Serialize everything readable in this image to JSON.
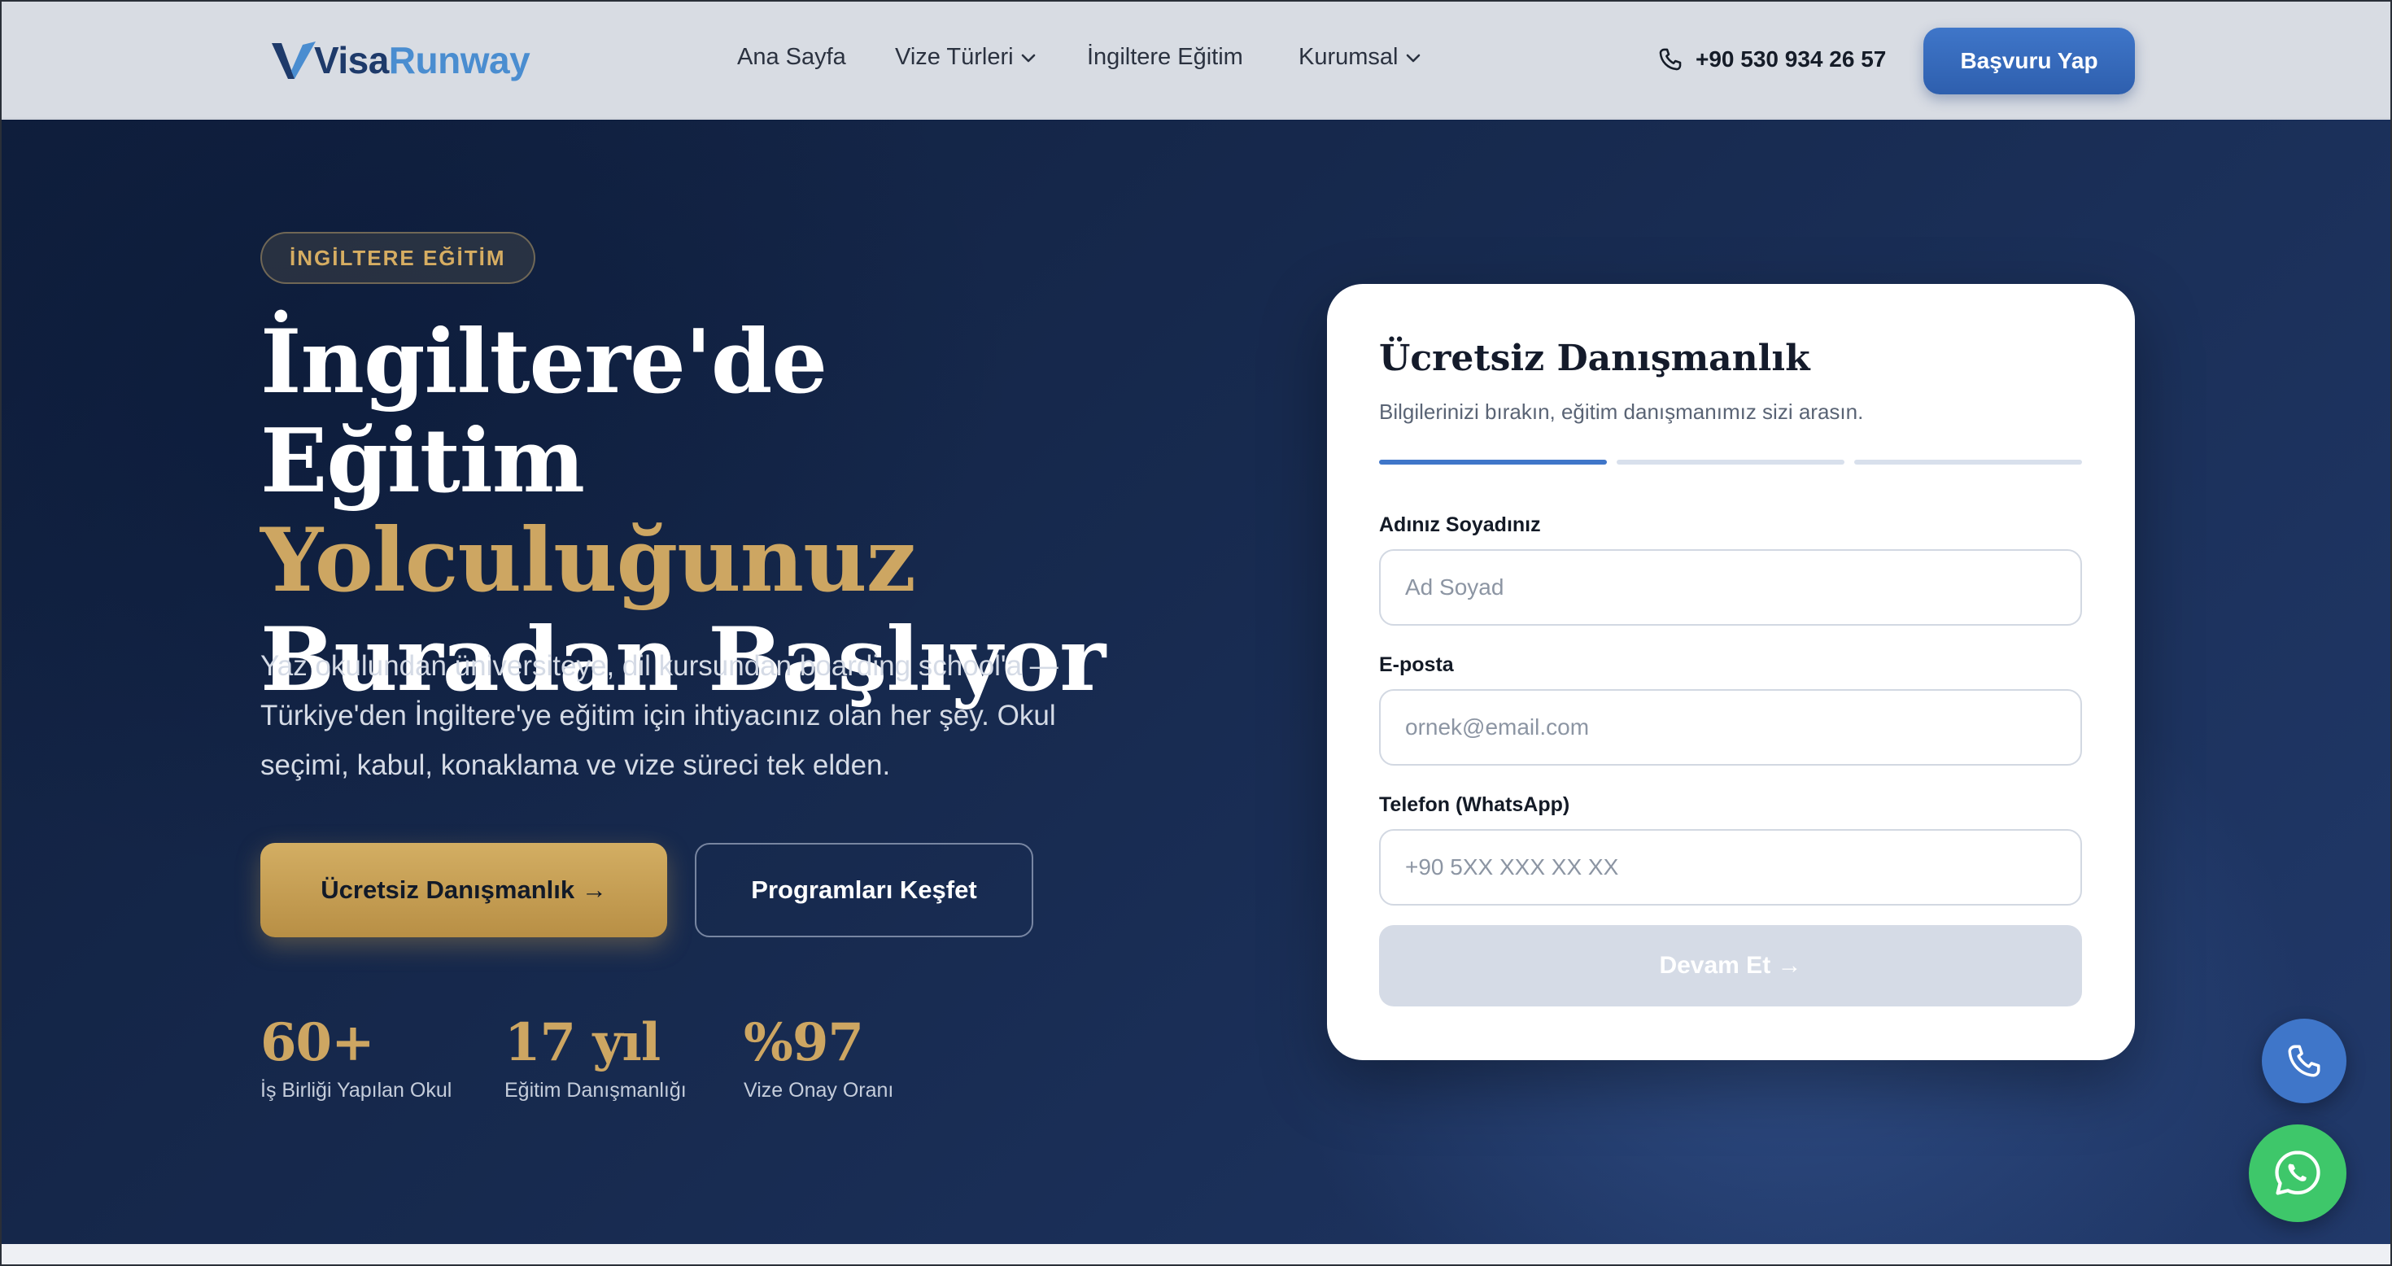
{
  "brand": {
    "part1": "Visa",
    "part2": "Runway",
    "accent": "#4a8dd0",
    "dark": "#1e3a6a"
  },
  "nav": {
    "home": "Ana Sayfa",
    "visa_types": "Vize Türleri",
    "uk_education": "İngiltere Eğitim",
    "corporate": "Kurumsal"
  },
  "header": {
    "phone": "+90 530 934 26 57",
    "apply_label": "Başvuru Yap"
  },
  "hero": {
    "badge": "İNGİLTERE EĞİTİM",
    "headline_line1": "İngiltere'de Eğitim",
    "headline_line2": "Yolculuğunuz",
    "headline_line3": "Buradan Başlıyor",
    "lead": "Yaz okulundan üniversiteye, dil kursundan boarding school'a — Türkiye'den İngiltere'ye eğitim için ihtiyacınız olan her şey. Okul seçimi, kabul, konaklama ve vize süreci tek elden.",
    "cta_primary": "Ücretsiz Danışmanlık →",
    "cta_secondary": "Programları Keşfet",
    "gold": "#cda662"
  },
  "stats": [
    {
      "value": "60+",
      "label": "İş Birliği Yapılan Okul"
    },
    {
      "value": "17 yıl",
      "label": "Eğitim Danışmanlığı"
    },
    {
      "value": "%97",
      "label": "Vize Onay Oranı"
    }
  ],
  "form": {
    "title": "Ücretsiz Danışmanlık",
    "subtitle": "Bilgilerinizi bırakın, eğitim danışmanımız sizi arasın.",
    "progress_step": 1,
    "progress_total": 3,
    "name_label": "Adınız Soyadınız",
    "name_placeholder": "Ad Soyad",
    "email_label": "E-posta",
    "email_placeholder": "ornek@email.com",
    "phone_label": "Telefon (WhatsApp)",
    "phone_placeholder": "+90 5XX XXX XX XX",
    "submit_label": "Devam Et →"
  },
  "floating": {
    "call_icon": "phone-icon",
    "whatsapp_icon": "whatsapp-icon"
  }
}
